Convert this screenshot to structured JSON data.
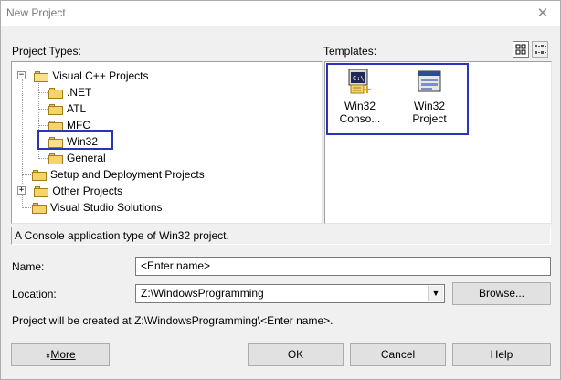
{
  "window": {
    "title": "New Project",
    "close_glyph": "✕"
  },
  "project_types": {
    "label": "Project Types:",
    "items": [
      {
        "label": "Visual C++ Projects",
        "expander": "−",
        "icon": "folder-open-icon"
      },
      {
        "label": ".NET",
        "icon": "folder-icon"
      },
      {
        "label": "ATL",
        "icon": "folder-icon"
      },
      {
        "label": "MFC",
        "icon": "folder-icon"
      },
      {
        "label": "Win32",
        "icon": "folder-open-icon",
        "selected": true
      },
      {
        "label": "General",
        "icon": "folder-icon"
      },
      {
        "label": "Setup and Deployment Projects",
        "icon": "folder-icon"
      },
      {
        "label": "Other Projects",
        "expander": "+",
        "icon": "folder-icon"
      },
      {
        "label": "Visual Studio Solutions",
        "icon": "folder-icon"
      }
    ]
  },
  "templates": {
    "label": "Templates:",
    "items": [
      {
        "line1": "Win32",
        "line2": "Conso...",
        "icon": "console-app-icon"
      },
      {
        "line1": "Win32",
        "line2": "Project",
        "icon": "win32-project-icon"
      }
    ]
  },
  "description": "A Console application type of Win32 project.",
  "name": {
    "label": "Name:",
    "value": "<Enter name>"
  },
  "location": {
    "label": "Location:",
    "value": "Z:\\WindowsProgramming",
    "dropdown_glyph": "▼"
  },
  "browse_label": "Browse...",
  "created_at": "Project will be created at Z:\\WindowsProgramming\\<Enter name>.",
  "buttons": {
    "more_glyph": "⯯",
    "more": "More",
    "ok": "OK",
    "cancel": "Cancel",
    "help": "Help"
  },
  "colors": {
    "highlight": "#2b35b8",
    "folder": "#f6d46a"
  }
}
